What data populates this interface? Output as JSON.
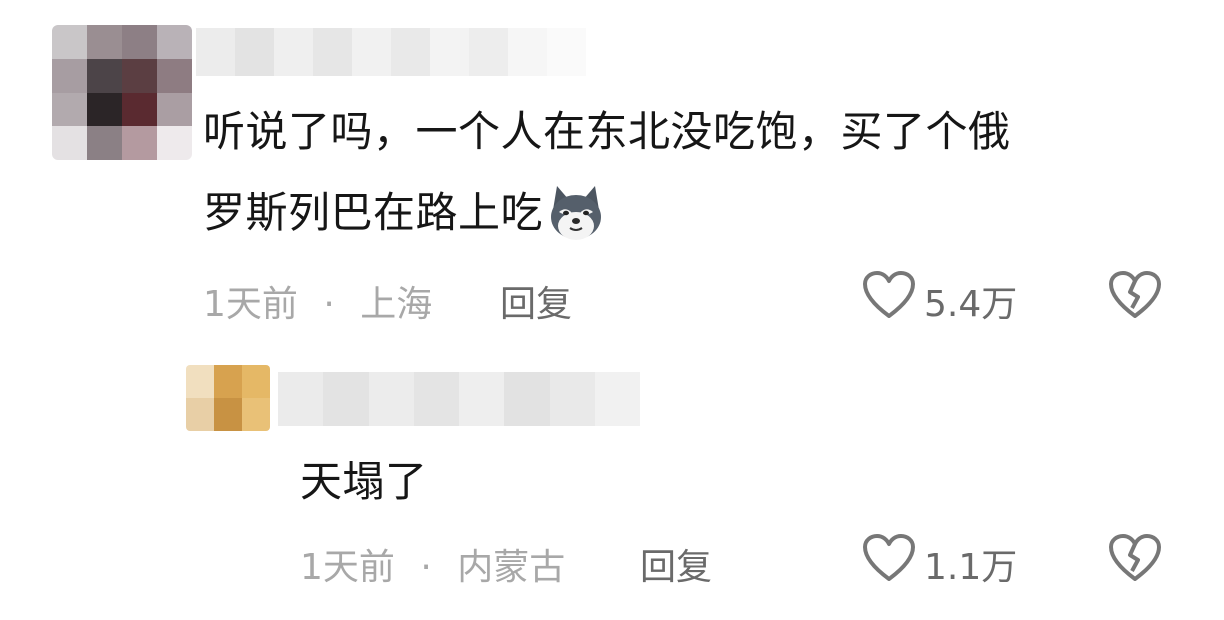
{
  "comments": [
    {
      "text_line1": "听说了吗，一个人在东北没吃饱，买了个俄",
      "text_line2": "罗斯列巴在路上吃",
      "emoji": "smirking-husky-emoji",
      "time": "1天前",
      "separator": "·",
      "location": "上海",
      "reply_label": "回复",
      "likes": "5.4万"
    },
    {
      "text": "天塌了",
      "time": "1天前",
      "separator": "·",
      "location": "内蒙古",
      "reply_label": "回复",
      "likes": "1.1万"
    }
  ],
  "icons": {
    "like": "heart-outline-icon",
    "dislike": "broken-heart-icon"
  },
  "colors": {
    "text": "#161616",
    "meta": "#a8a8a8",
    "action": "#6a6a6a",
    "icon": "#777777"
  }
}
